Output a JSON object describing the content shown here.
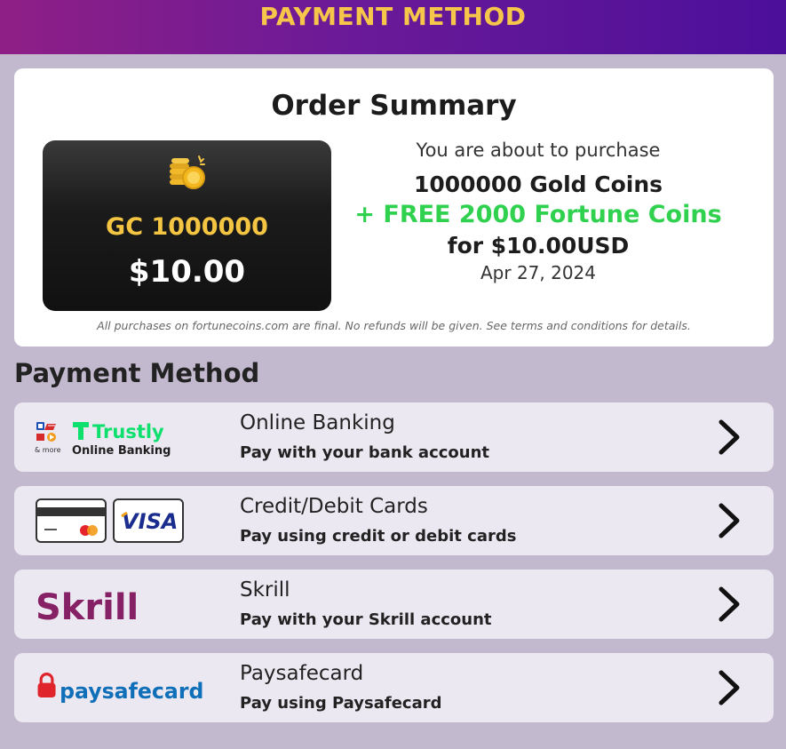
{
  "header": {
    "title": "PAYMENT METHOD"
  },
  "summary": {
    "title": "Order Summary",
    "coin_card": {
      "amount": "GC 1000000",
      "price": "$10.00",
      "icon": "gold-coins-icon"
    },
    "lead": "You are about to purchase",
    "gold_line": "1000000 Gold Coins",
    "free_line": "+ FREE 2000 Fortune Coins",
    "price_line": "for $10.00USD",
    "date": "Apr 27, 2024",
    "disclaimer": "All purchases on fortunecoins.com are final. No refunds will be given. See terms and conditions for details."
  },
  "payment": {
    "section_title": "Payment Method",
    "methods": [
      {
        "name": "Online Banking",
        "desc": "Pay with your bank account",
        "logo": "trustly-logo",
        "logo_text": "Trustly",
        "logo_sub": "Online Banking",
        "logo_more": "& more"
      },
      {
        "name": "Credit/Debit Cards",
        "desc": "Pay using credit or debit cards",
        "logo": "visa-card-logo",
        "logo_text": "VISA"
      },
      {
        "name": "Skrill",
        "desc": "Pay with your Skrill account",
        "logo": "skrill-logo",
        "logo_text": "Skrill"
      },
      {
        "name": "Paysafecard",
        "desc": "Pay using Paysafecard",
        "logo": "paysafecard-logo",
        "logo_text": "paysafecard"
      }
    ]
  },
  "colors": {
    "accent_gold": "#f6c64a",
    "free_green": "#2fd14f",
    "trustly_green": "#0ee06e",
    "skrill_purple": "#862165",
    "paysafe_red": "#e0242b",
    "paysafe_blue": "#0f6fb8"
  }
}
